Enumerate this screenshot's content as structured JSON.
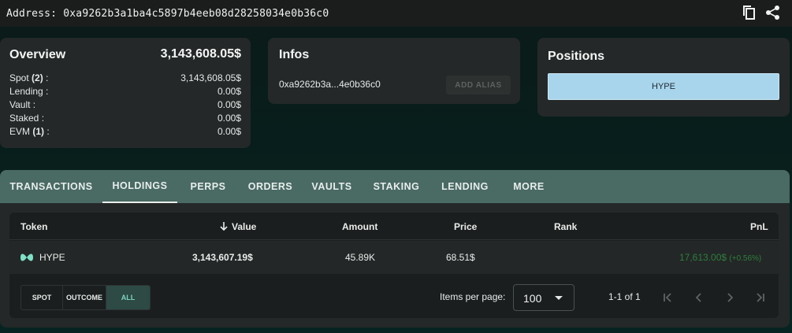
{
  "topbar": {
    "address": "Address: 0xa9262b3a1ba4c5897b4eeb08d28258034e0b36c0",
    "icons": [
      "copy-icon",
      "share-icon"
    ]
  },
  "overview": {
    "title": "Overview",
    "total": "3,143,608.05$",
    "rows": [
      {
        "label": "Spot ",
        "count": "(2)",
        "suffix": " :",
        "value": "3,143,608.05$"
      },
      {
        "label": "Lending :",
        "count": "",
        "suffix": "",
        "value": "0.00$"
      },
      {
        "label": "Vault :",
        "count": "",
        "suffix": "",
        "value": "0.00$"
      },
      {
        "label": "Staked :",
        "count": "",
        "suffix": "",
        "value": "0.00$"
      },
      {
        "label": "EVM ",
        "count": "(1)",
        "suffix": " :",
        "value": "0.00$"
      }
    ]
  },
  "infos": {
    "title": "Infos",
    "short_address": "0xa9262b3a...4e0b36c0",
    "add_alias": "ADD ALIAS"
  },
  "positions": {
    "title": "Positions",
    "items": [
      "HYPE"
    ]
  },
  "tabs": [
    "TRANSACTIONS",
    "HOLDINGS",
    "PERPS",
    "ORDERS",
    "VAULTS",
    "STAKING",
    "LENDING",
    "MORE"
  ],
  "active_tab": "HOLDINGS",
  "table": {
    "headers": {
      "token": "Token",
      "value": "Value",
      "amount": "Amount",
      "price": "Price",
      "rank": "Rank",
      "pnl": "PnL"
    },
    "rows": [
      {
        "token": "HYPE",
        "value": "3,143,607.19$",
        "amount": "45.89K",
        "price": "68.51$",
        "rank": "",
        "pnl": "17,613.00$",
        "pnl_pct": "(+0.56%)"
      }
    ]
  },
  "filters": [
    "SPOT",
    "OUTCOME",
    "ALL"
  ],
  "active_filter": "ALL",
  "pagination": {
    "items_per_page_label": "Items per page:",
    "items_per_page": "100",
    "range": "1-1 of 1"
  },
  "colors": {
    "background": "#062421",
    "card": "#242828",
    "tabbar": "#4a6a64",
    "position_chip": "#a9d5ec",
    "pnl_positive": "#2f7e3d",
    "active_filter": "#7fd1bd"
  }
}
